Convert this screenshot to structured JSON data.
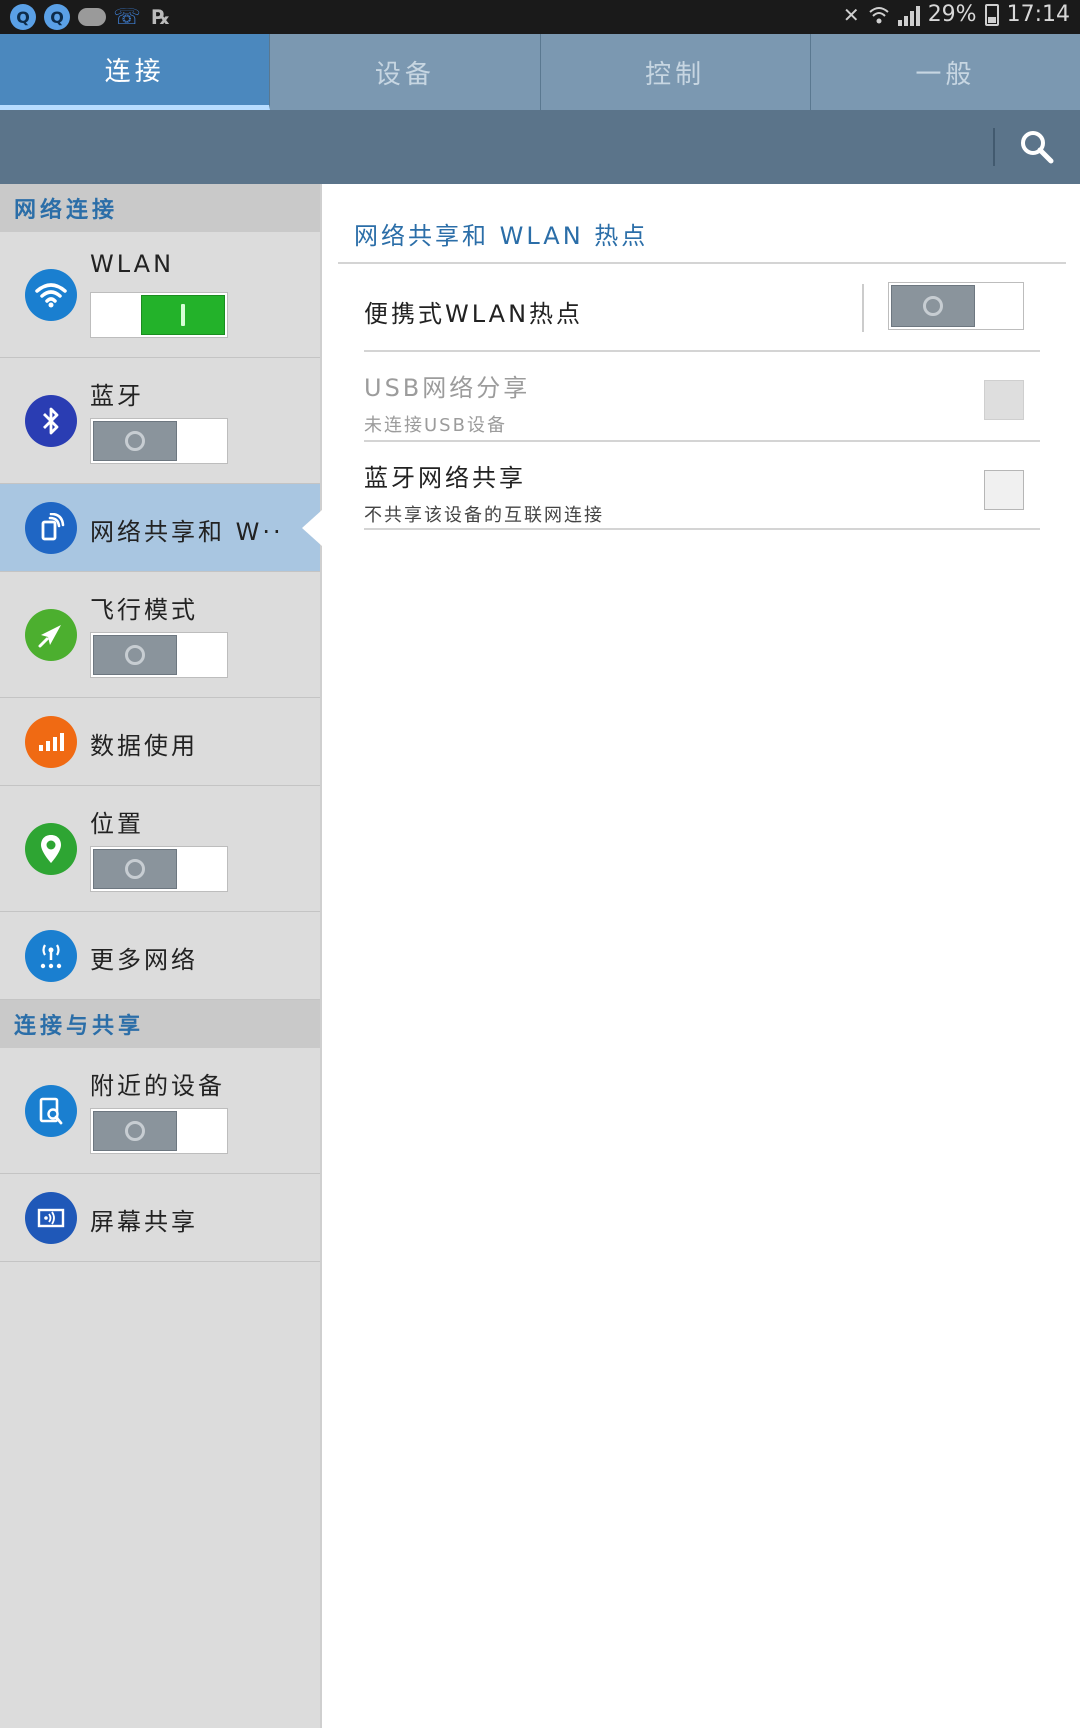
{
  "status_bar": {
    "time": "17:14",
    "battery": "29%"
  },
  "tabs": [
    {
      "label": "连接",
      "active": true
    },
    {
      "label": "设备",
      "active": false
    },
    {
      "label": "控制",
      "active": false
    },
    {
      "label": "一般",
      "active": false
    }
  ],
  "sidebar": {
    "section1": "网络连接",
    "section2": "连接与共享",
    "items": [
      {
        "label": "WLAN",
        "icon": "wifi-icon",
        "color": "#1a7fd0",
        "toggle": true,
        "on": true
      },
      {
        "label": "蓝牙",
        "icon": "bluetooth-icon",
        "color": "#2a3db3",
        "toggle": true,
        "on": false
      },
      {
        "label": "网络共享和 W··",
        "icon": "tethering-icon",
        "color": "#1f66c4",
        "active": true
      },
      {
        "label": "飞行模式",
        "icon": "airplane-icon",
        "color": "#4caf2f",
        "toggle": true,
        "on": false
      },
      {
        "label": "数据使用",
        "icon": "data-usage-icon",
        "color": "#f06a13"
      },
      {
        "label": "位置",
        "icon": "location-icon",
        "color": "#2ea533",
        "toggle": true,
        "on": false
      },
      {
        "label": "更多网络",
        "icon": "more-networks-icon",
        "color": "#1a7fd0"
      },
      {
        "label": "附近的设备",
        "icon": "nearby-devices-icon",
        "color": "#1a7fd0",
        "toggle": true,
        "on": false
      },
      {
        "label": "屏幕共享",
        "icon": "screen-share-icon",
        "color": "#1f58b8"
      }
    ]
  },
  "main": {
    "title": "网络共享和 WLAN 热点",
    "rows": [
      {
        "title": "便携式WLAN热点",
        "subtitle": "",
        "control": "toggle",
        "on": false
      },
      {
        "title": "USB网络分享",
        "subtitle": "未连接USB设备",
        "control": "checkbox",
        "disabled": true
      },
      {
        "title": "蓝牙网络共享",
        "subtitle": "不共享该设备的互联网连接",
        "control": "checkbox",
        "disabled": false
      }
    ]
  },
  "colors": {
    "accent": "#2b6ea8",
    "tab_active": "#4b88be",
    "actionbar": "#5b748a",
    "toggle_on": "#23b22a"
  }
}
